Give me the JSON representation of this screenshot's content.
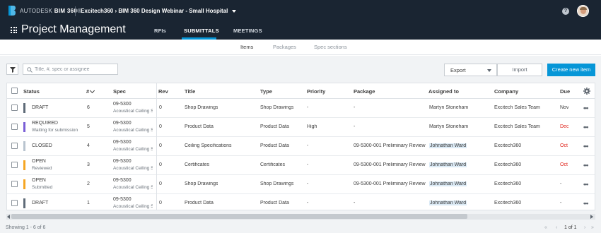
{
  "header": {
    "brand_prefix": "AUTODESK",
    "brand_product": "BIM 360",
    "brand_suffix": "®",
    "account": "Excitech360",
    "project": "BIM 360 Design Webinar - Small Hospital",
    "help_label": "?",
    "app_title": "Project Management",
    "tabs": [
      {
        "label": "RFIs",
        "active": false
      },
      {
        "label": "SUBMITTALS",
        "active": true
      },
      {
        "label": "MEETINGS",
        "active": false
      }
    ]
  },
  "subtabs": [
    {
      "label": "Items",
      "active": true
    },
    {
      "label": "Packages",
      "active": false
    },
    {
      "label": "Spec sections",
      "active": false
    }
  ],
  "toolbar": {
    "search_placeholder": "Title, #, spec or assignee",
    "export_label": "Export",
    "import_label": "Import",
    "create_label": "Create new item"
  },
  "table": {
    "columns": {
      "status": "Status",
      "number": "#",
      "spec": "Spec",
      "rev": "Rev",
      "title": "Title",
      "type": "Type",
      "priority": "Priority",
      "package": "Package",
      "assigned": "Assigned to",
      "company": "Company",
      "due": "Due"
    },
    "rows": [
      {
        "status": "DRAFT",
        "status_sub": "",
        "status_color": "#5f6b78",
        "number": "6",
        "spec_code": "09-5300",
        "spec_name": "Acoustical Ceiling Suspension",
        "rev": "0",
        "title": "Shop Drawings",
        "type": "Shop Drawings",
        "priority": "-",
        "package": "-",
        "assigned": "Martyn Stoneham",
        "assigned_tag": false,
        "company": "Excitech Sales Team",
        "due": "Nov",
        "due_overdue": false
      },
      {
        "status": "REQUIRED",
        "status_sub": "Waiting for submission",
        "status_color": "#7a5fd6",
        "number": "5",
        "spec_code": "09-5300",
        "spec_name": "Acoustical Ceiling Suspension",
        "rev": "0",
        "title": "Product Data",
        "type": "Product Data",
        "priority": "High",
        "package": "-",
        "assigned": "Martyn Stoneham",
        "assigned_tag": false,
        "company": "Excitech Sales Team",
        "due": "Dec",
        "due_overdue": true
      },
      {
        "status": "CLOSED",
        "status_sub": "",
        "status_color": "#b9c4cf",
        "number": "4",
        "spec_code": "09-5300",
        "spec_name": "Acoustical Ceiling Suspension",
        "rev": "0",
        "title": "Ceiling Specifications",
        "type": "Product Data",
        "priority": "-",
        "package": "09-5300-001 Preliminary Review",
        "assigned": "Johnathan Ward",
        "assigned_tag": true,
        "company": "Excitech360",
        "due": "Oct",
        "due_overdue": true
      },
      {
        "status": "OPEN",
        "status_sub": "Reviewed",
        "status_color": "#f5a623",
        "number": "3",
        "spec_code": "09-5300",
        "spec_name": "Acoustical Ceiling Suspension",
        "rev": "0",
        "title": "Certificates",
        "type": "Certificates",
        "priority": "-",
        "package": "09-5300-001 Preliminary Review",
        "assigned": "Johnathan Ward",
        "assigned_tag": true,
        "company": "Excitech360",
        "due": "Oct",
        "due_overdue": true
      },
      {
        "status": "OPEN",
        "status_sub": "Submitted",
        "status_color": "#f5a623",
        "number": "2",
        "spec_code": "09-5300",
        "spec_name": "Acoustical Ceiling Suspension",
        "rev": "0",
        "title": "Shop Drawings",
        "type": "Shop Drawings",
        "priority": "-",
        "package": "09-5300-001 Preliminary Review",
        "assigned": "Johnathan Ward",
        "assigned_tag": true,
        "company": "Excitech360",
        "due": "-",
        "due_overdue": false
      },
      {
        "status": "DRAFT",
        "status_sub": "",
        "status_color": "#5f6b78",
        "number": "1",
        "spec_code": "09-5300",
        "spec_name": "Acoustical Ceiling Suspension",
        "rev": "0",
        "title": "Product Data",
        "type": "Product Data",
        "priority": "-",
        "package": "-",
        "assigned": "Johnathan Ward",
        "assigned_tag": true,
        "company": "Excitech360",
        "due": "-",
        "due_overdue": false
      }
    ]
  },
  "footer": {
    "showing": "Showing 1 - 6 of 6",
    "page": "1",
    "of": "of 1"
  },
  "colors": {
    "topbar": "#1a2532",
    "accent": "#0696d7",
    "overdue": "#e0231a"
  }
}
